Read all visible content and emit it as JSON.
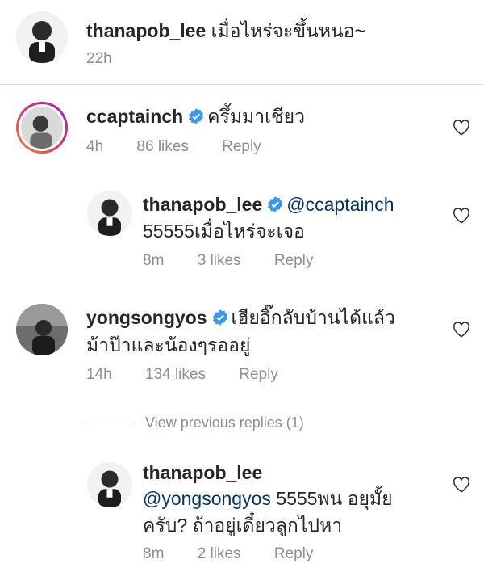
{
  "caption": {
    "username": "thanapob_lee",
    "text": "เมื่อไหร่จะขึ้นหนอ~",
    "time": "22h"
  },
  "comments": [
    {
      "username": "ccaptainch",
      "verified": true,
      "line1": "ครึ้มมาเชียว",
      "time": "4h",
      "likes": "86 likes",
      "reply": "Reply"
    },
    {
      "username": "thanapob_lee",
      "verified": true,
      "mention": "@ccaptainch",
      "line2": "55555เมื่อไหร่จะเจอ",
      "time": "8m",
      "likes": "3 likes",
      "reply": "Reply"
    },
    {
      "username": "yongsongyos",
      "verified": true,
      "line1": "เฮียอิ๊กลับบ้านได้แล้ว",
      "line2": "ม้าป๊าและน้องๆรออยู่",
      "time": "14h",
      "likes": "134 likes",
      "reply": "Reply"
    },
    {
      "username": "thanapob_lee",
      "mention": "@yongsongyos",
      "line2_rest": " 5555พน อยุมั้ย",
      "line3": "ครับ? ถ้าอยู่เดี๋ยวลูกไปหา",
      "time": "8m",
      "likes": "2 likes",
      "reply": "Reply"
    }
  ],
  "view_previous": "View previous replies (1)",
  "colors": {
    "text": "#262626",
    "muted": "#8e8e8e",
    "mention": "#003569",
    "verified": "#3897f0",
    "divider": "#dbdbdb"
  }
}
